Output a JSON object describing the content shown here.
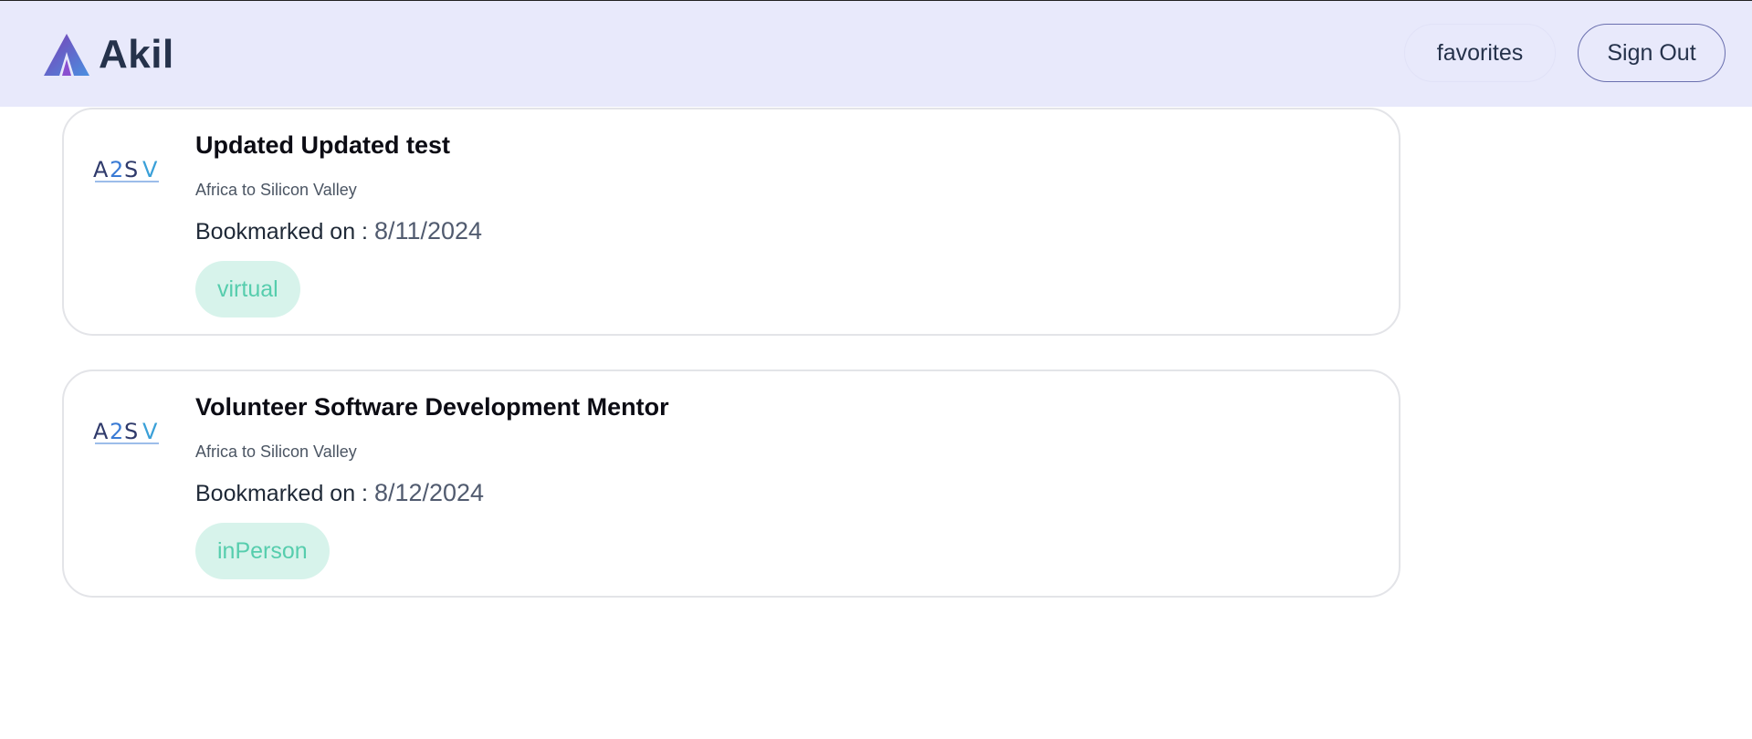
{
  "header": {
    "brand": "Akil",
    "favorites_label": "favorites",
    "signout_label": "Sign Out"
  },
  "cards": [
    {
      "title": "Updated Updated test",
      "organization": "Africa to Silicon Valley",
      "bookmarked_prefix": "Bookmarked on : ",
      "bookmarked_date": "8/11/2024",
      "tag": "virtual"
    },
    {
      "title": "Volunteer Software Development Mentor",
      "organization": "Africa to Silicon Valley",
      "bookmarked_prefix": "Bookmarked on : ",
      "bookmarked_date": "8/12/2024",
      "tag": "inPerson"
    }
  ],
  "colors": {
    "header_bg": "#e8e9fb",
    "brand_text": "#25324b",
    "tag_bg": "#d7f3eb",
    "tag_text": "#56cdad",
    "card_border": "#e3e4e8"
  },
  "icons": {
    "brand_logo": "akil-triangle-logo",
    "company_logo": "a2sv-logo"
  }
}
